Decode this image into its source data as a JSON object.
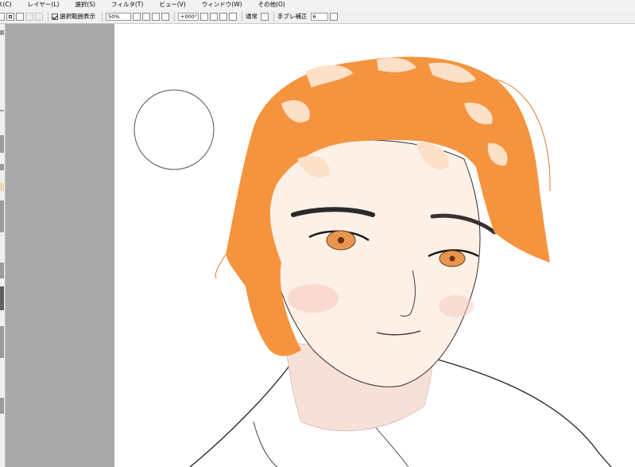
{
  "menu": {
    "items": [
      "ス(C)",
      "レイヤー(L)",
      "選択(S)",
      "フィルタ(T)",
      "ビュー(V)",
      "ウィンドウ(W)",
      "その他(O)"
    ]
  },
  "toolbar": {
    "selection_checkbox_label": "選択範囲表示",
    "selection_checked": true,
    "zoom_value": "50%",
    "rotation_value": "+000°",
    "blend_mode": "通常",
    "stabilizer_label": "手ブレ補正",
    "stabilizer_value": "6"
  },
  "colors": {
    "hair": "#f5943f",
    "hair_highlight": "#fde0c8",
    "skin": "#fdf0e6",
    "canvas_gray": "#a9a9a9"
  },
  "icons": {
    "brush_cursor": "circle-outline"
  }
}
